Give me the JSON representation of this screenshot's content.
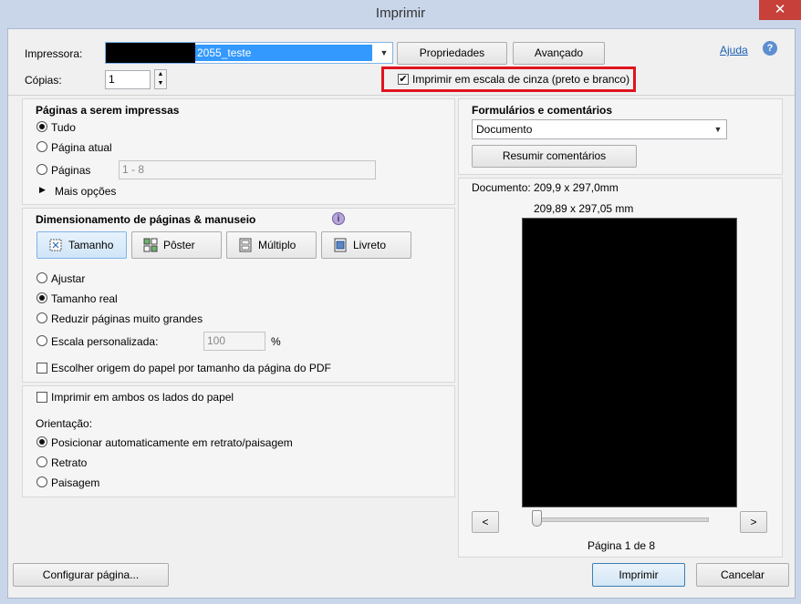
{
  "window": {
    "title": "Imprimir",
    "close_glyph": "✕"
  },
  "printer": {
    "label": "Impressora:",
    "selected": "2055_teste",
    "properties_button": "Propriedades",
    "advanced_button": "Avançado",
    "help_link": "Ajuda",
    "help_glyph": "?"
  },
  "copies": {
    "label": "Cópias:",
    "value": "1"
  },
  "grayscale": {
    "label": "Imprimir em escala de cinza (preto e branco)",
    "checked": true,
    "highlight_color": "#e0141e"
  },
  "pages": {
    "heading": "Páginas a serem impressas",
    "all": "Tudo",
    "current": "Página atual",
    "range_label": "Páginas",
    "range_value": "1 - 8",
    "more_options": "Mais opções"
  },
  "sizing": {
    "heading": "Dimensionamento de páginas & manuseio",
    "tools": [
      "Tamanho",
      "Pôster",
      "Múltiplo",
      "Livreto"
    ],
    "fit": "Ajustar",
    "actual": "Tamanho real",
    "shrink": "Reduzir páginas muito grandes",
    "custom": "Escala personalizada:",
    "custom_value": "100",
    "percent": "%",
    "paper_source": "Escolher origem do papel por tamanho da página do PDF"
  },
  "duplex": {
    "label": "Imprimir em ambos os lados do papel"
  },
  "orientation": {
    "heading": "Orientação:",
    "auto": "Posicionar automaticamente em retrato/paisagem",
    "portrait": "Retrato",
    "landscape": "Paisagem"
  },
  "forms": {
    "heading": "Formulários e comentários",
    "selected": "Documento",
    "summarize_button": "Resumir comentários"
  },
  "preview": {
    "doc_size": "Documento: 209,9 x 297,0mm",
    "page_size": "209,89 x 297,05 mm",
    "prev": "<",
    "next": ">",
    "page_info": "Página 1 de 8"
  },
  "footer": {
    "page_setup": "Configurar página...",
    "print": "Imprimir",
    "cancel": "Cancelar"
  }
}
